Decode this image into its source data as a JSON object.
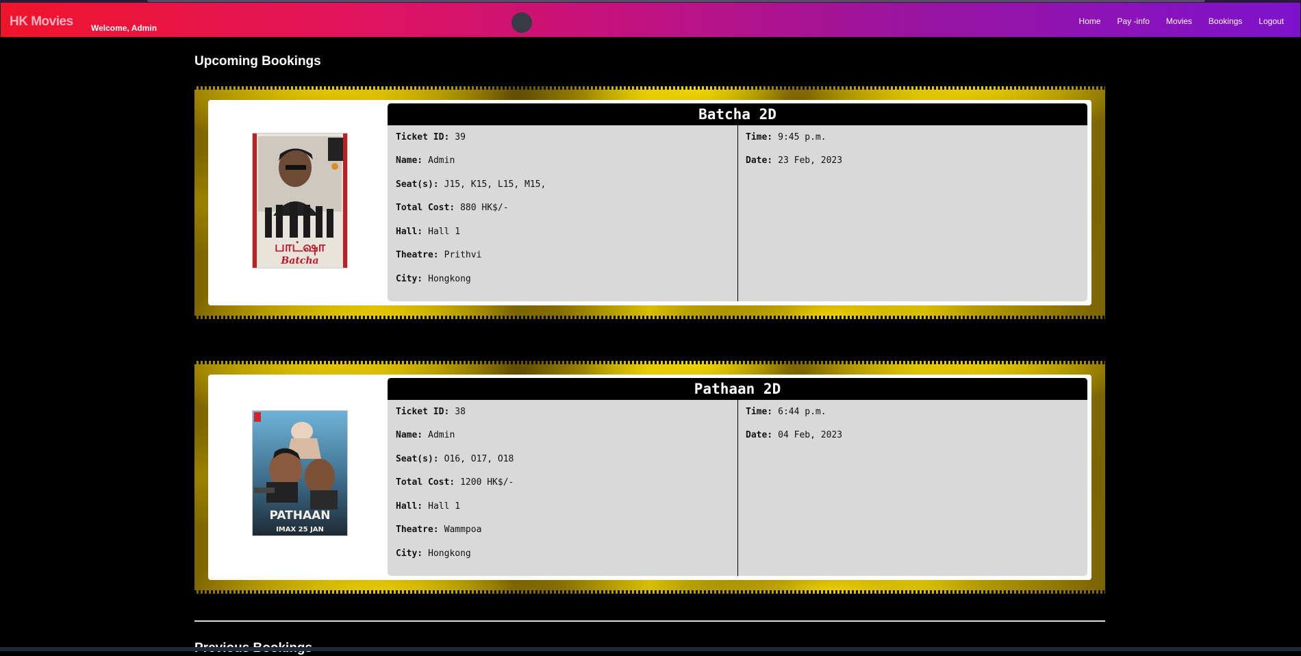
{
  "navbar": {
    "brand": "HK Movies",
    "welcome": "Welcome, Admin",
    "links": [
      "Home",
      "Pay -info",
      "Movies",
      "Bookings",
      "Logout"
    ]
  },
  "upcoming": {
    "title": "Upcoming Bookings",
    "bookings": [
      {
        "movie": "Batcha 2D",
        "poster_caption": "Batcha",
        "ticket_id_label": "Ticket ID:",
        "ticket_id": "39",
        "name_label": "Name:",
        "name": "Admin",
        "seats_label": "Seat(s):",
        "seats": "J15, K15, L15, M15,",
        "cost_label": "Total Cost:",
        "cost": "880 HK$/-",
        "hall_label": "Hall:",
        "hall": "Hall 1",
        "theatre_label": "Theatre:",
        "theatre": "Prithvi",
        "city_label": "City:",
        "city": "Hongkong",
        "time_label": "Time:",
        "time": "9:45 p.m.",
        "date_label": "Date:",
        "date": "23 Feb, 2023"
      },
      {
        "movie": "Pathaan 2D",
        "poster_caption": "PATHAAN",
        "ticket_id_label": "Ticket ID:",
        "ticket_id": "38",
        "name_label": "Name:",
        "name": "Admin",
        "seats_label": "Seat(s):",
        "seats": "O16, O17, O18",
        "cost_label": "Total Cost:",
        "cost": "1200 HK$/-",
        "hall_label": "Hall:",
        "hall": "Hall 1",
        "theatre_label": "Theatre:",
        "theatre": "Wammpoa",
        "city_label": "City:",
        "city": "Hongkong",
        "time_label": "Time:",
        "time": "6:44 p.m.",
        "date_label": "Date:",
        "date": "04 Feb, 2023"
      }
    ]
  },
  "previous": {
    "title": "Previous Bookings"
  }
}
